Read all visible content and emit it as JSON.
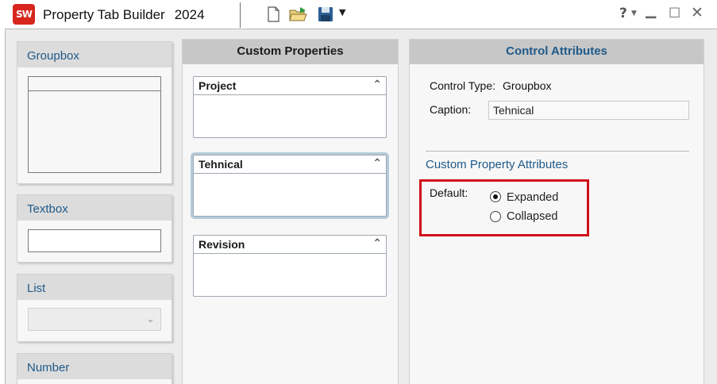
{
  "window": {
    "app_logo_text": "SW",
    "title": "Property Tab Builder",
    "year": "2024",
    "toolbar_icons": [
      "new-document-icon",
      "open-folder-icon",
      "save-icon",
      "dropdown-arrow-icon"
    ],
    "help_icon": "?",
    "controls": [
      "minimize-icon",
      "maximize-icon",
      "close-icon"
    ]
  },
  "toolbox": {
    "items": [
      {
        "label": "Groupbox"
      },
      {
        "label": "Textbox"
      },
      {
        "label": "List"
      },
      {
        "label": "Number"
      }
    ]
  },
  "custom_properties": {
    "header": "Custom Properties",
    "groups": [
      {
        "title": "Project",
        "selected": false
      },
      {
        "title": "Tehnical",
        "selected": true
      },
      {
        "title": "Revision",
        "selected": false
      }
    ]
  },
  "control_attributes": {
    "header": "Control Attributes",
    "control_type_label": "Control Type:",
    "control_type_value": "Groupbox",
    "caption_label": "Caption:",
    "caption_value": "Tehnical",
    "section_title": "Custom Property Attributes",
    "default_label": "Default:",
    "options": [
      {
        "label": "Expanded",
        "checked": true
      },
      {
        "label": "Collapsed",
        "checked": false
      }
    ],
    "highlight_color": "#d0101a"
  },
  "colors": {
    "accent_blue": "#1f5a8a",
    "logo_red": "#d7261d"
  }
}
